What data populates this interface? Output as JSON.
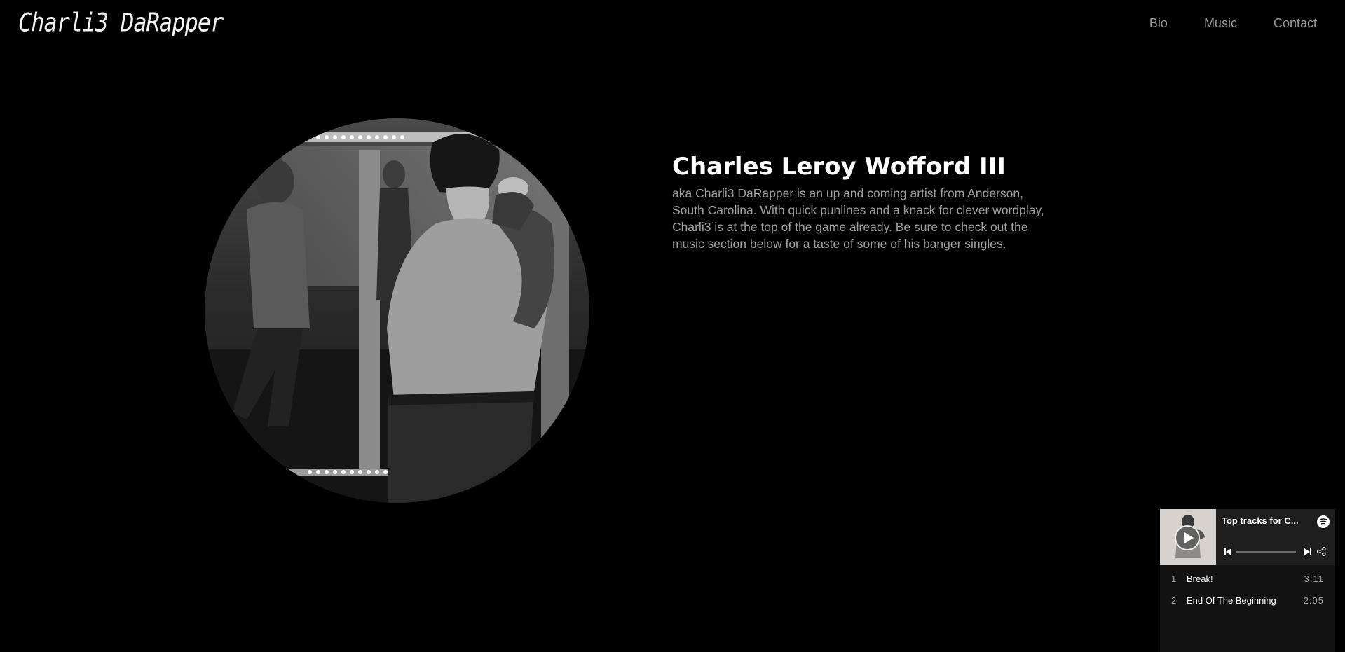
{
  "header": {
    "logo": "Charli3 DaRapper",
    "nav": [
      "Bio",
      "Music",
      "Contact"
    ]
  },
  "bio": {
    "name": "Charles Leroy Wofford III",
    "description": "aka Charli3 DaRapper is an up and coming artist from Anderson, South Carolina. With quick punlines and a knack for clever wordplay, Charli3 is at the top of the game already. Be sure to check out the music section below for a taste of some of his banger singles."
  },
  "spotify": {
    "title": "Top tracks for C...",
    "tracks": [
      {
        "num": "1",
        "name": "Break!",
        "duration": "3:11"
      },
      {
        "num": "2",
        "name": "End Of The Beginning",
        "duration": "2:05"
      }
    ],
    "icons": [
      "play-icon",
      "spotify-logo-icon",
      "previous-icon",
      "next-icon",
      "share-icon"
    ]
  },
  "colors": {
    "background": "#000000",
    "nav_text": "#9a9a9a",
    "body_text": "#a0a0a0",
    "widget_bg": "#121212"
  }
}
